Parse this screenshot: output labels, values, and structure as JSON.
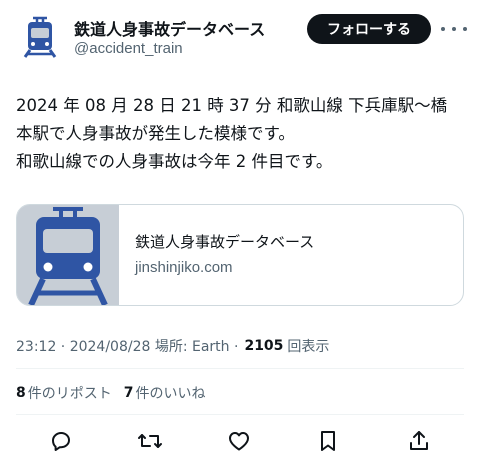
{
  "account": {
    "name": "鉄道人身事故データベース",
    "handle": "@accident_train",
    "follow_label": "フォローする"
  },
  "tweet": {
    "lines": [
      "2024 年 08 月 28 日 21 時 37 分 和歌山線 下兵庫駅〜橋",
      "本駅で人身事故が発生した模様です。",
      "和歌山線での人身事故は今年 2 件目です。"
    ]
  },
  "card": {
    "title": "鉄道人身事故データベース",
    "domain": "jinshinjiko.com"
  },
  "meta": {
    "timestamp": "23:12 · 2024/08/28 場所: Earth ·",
    "views_count": "2105",
    "views_label": "回表示"
  },
  "stats": {
    "reposts_count": "8",
    "reposts_label": "件のリポスト",
    "likes_count": "7",
    "likes_label": "件のいいね"
  },
  "colors": {
    "accent": "#2f55a4",
    "thumb_bg": "#c7ced6",
    "text_primary": "#0f1419",
    "text_secondary": "#536471",
    "border": "#cfd9de"
  },
  "icons": [
    "train-icon",
    "more-icon",
    "reply-icon",
    "retweet-icon",
    "like-icon",
    "bookmark-icon",
    "share-icon"
  ]
}
